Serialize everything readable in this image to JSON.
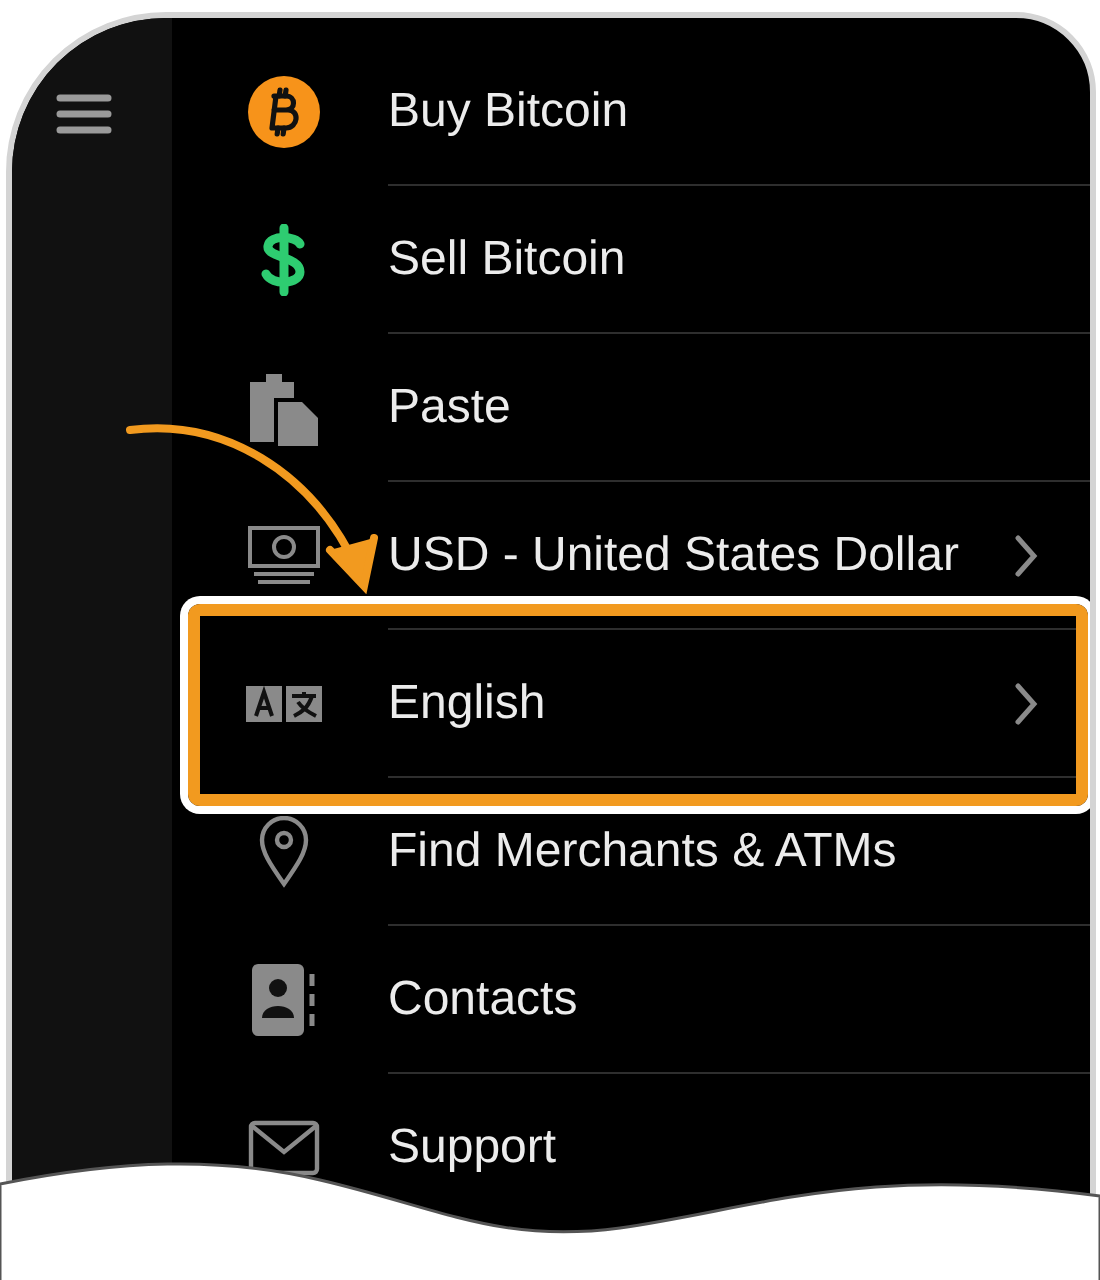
{
  "menu": {
    "items": [
      {
        "kind": "bitcoin",
        "label": "Buy Bitcoin",
        "chevron": false,
        "highlighted": false
      },
      {
        "kind": "dollar",
        "label": "Sell Bitcoin",
        "chevron": false,
        "highlighted": false
      },
      {
        "kind": "paste",
        "label": "Paste",
        "chevron": false,
        "highlighted": false
      },
      {
        "kind": "cash",
        "label": "USD - United States Dollar",
        "chevron": true,
        "highlighted": false
      },
      {
        "kind": "language",
        "label": "English",
        "chevron": true,
        "highlighted": true
      },
      {
        "kind": "pin",
        "label": "Find Merchants & ATMs",
        "chevron": false,
        "highlighted": false
      },
      {
        "kind": "contacts",
        "label": "Contacts",
        "chevron": false,
        "highlighted": false
      },
      {
        "kind": "mail",
        "label": "Support",
        "chevron": false,
        "highlighted": false
      }
    ]
  }
}
